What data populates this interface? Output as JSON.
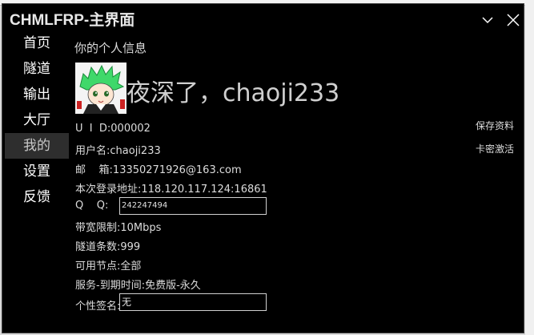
{
  "window": {
    "title": "CHMLFRP-主界面"
  },
  "nav": {
    "items": [
      {
        "label": "首页"
      },
      {
        "label": "隧道"
      },
      {
        "label": "输出"
      },
      {
        "label": "大厅"
      },
      {
        "label": "我的",
        "active": true
      },
      {
        "label": "设置"
      },
      {
        "label": "反馈"
      }
    ]
  },
  "profile": {
    "section_title": "你的个人信息",
    "avatar_icon": "anime-avatar-icon",
    "greeting": "夜深了，chaoji233",
    "uid_label": "U  I  D:",
    "uid_value": "000002",
    "username_label": "用户名:",
    "username_value": "chaoji233",
    "email_label": "邮    箱:",
    "email_value": "13350271926@163.com",
    "login_addr_label": "本次登录地址:",
    "login_addr_value": "118.120.117.124:16861",
    "qq_label": "Q    Q:",
    "qq_value": "242247494",
    "bandwidth_label": "带宽限制:",
    "bandwidth_value": "10Mbps",
    "tunnels_label": "隧道条数:",
    "tunnels_value": "999",
    "nodes_label": "可用节点:",
    "nodes_value": "全部",
    "service_label": "服务-到期时间:",
    "service_value": "免费版-永久",
    "signature_label": "个性签名:",
    "signature_value": "无"
  },
  "actions": {
    "save_label": "保存资料",
    "card_label": "卡密激活"
  },
  "colors": {
    "window_bg": "#000000",
    "text": "#dcdcdc",
    "active_nav_bg": "#2e2e2e"
  }
}
